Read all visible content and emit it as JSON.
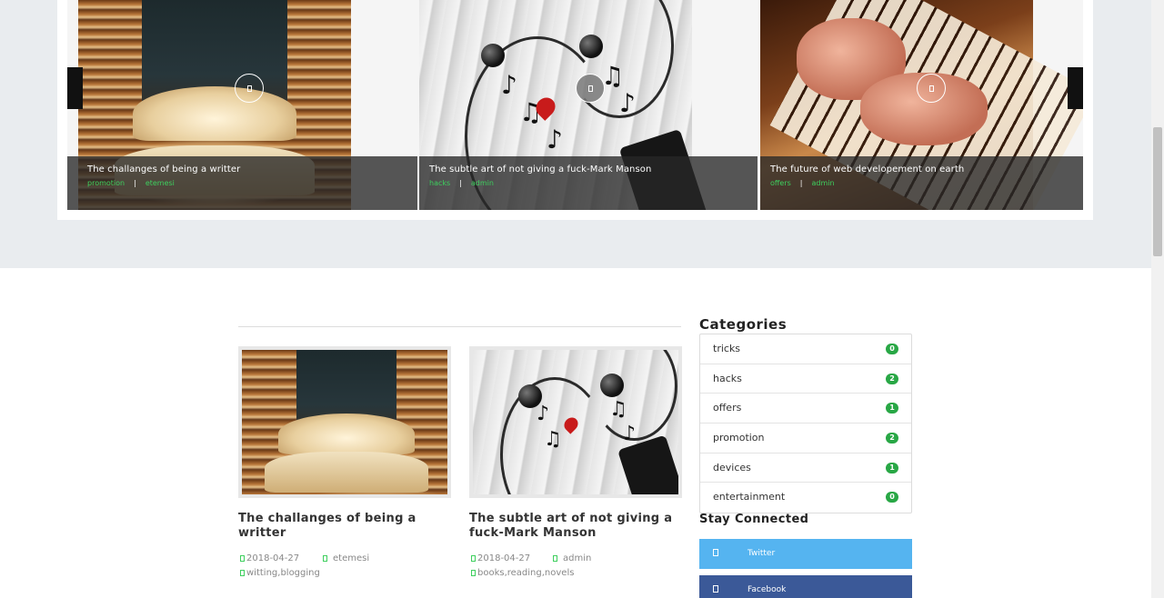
{
  "slider": {
    "slides": [
      {
        "title": "The challanges of being a writter",
        "category": "promotion",
        "author": "etemesi",
        "image": "books-stack"
      },
      {
        "title": "The subtle art of not giving a fuck-Mark Manson",
        "category": "hacks",
        "author": "admin",
        "image": "earphones-music"
      },
      {
        "title": "The future of web developement on earth",
        "category": "offers",
        "author": "admin",
        "image": "piano-hands"
      }
    ],
    "separator": "|",
    "prev_icon": "chevron-left-icon",
    "next_icon": "chevron-right-icon"
  },
  "posts": [
    {
      "title": "The challanges of being a writter",
      "date": "2018-04-27",
      "author": "etemesi",
      "tags": "witting,blogging",
      "image": "books-stack"
    },
    {
      "title": "The subtle art of not giving a fuck-Mark Manson",
      "date": "2018-04-27",
      "author": "admin",
      "tags": "books,reading,novels",
      "image": "earphones-music"
    }
  ],
  "sidebar": {
    "categories_title": "Categories",
    "categories": [
      {
        "label": "tricks",
        "count": "0"
      },
      {
        "label": "hacks",
        "count": "2"
      },
      {
        "label": "offers",
        "count": "1"
      },
      {
        "label": "promotion",
        "count": "2"
      },
      {
        "label": "devices",
        "count": "1"
      },
      {
        "label": "entertainment",
        "count": "0"
      }
    ],
    "stay_title": "Stay Connected",
    "social": [
      {
        "label": "Twitter",
        "color": "#55b4f0"
      },
      {
        "label": "Facebook",
        "color": "#3b5998"
      }
    ]
  },
  "colors": {
    "accent_green": "#3ecf5e",
    "badge_green": "#28a745",
    "band": "#e9ecef"
  }
}
